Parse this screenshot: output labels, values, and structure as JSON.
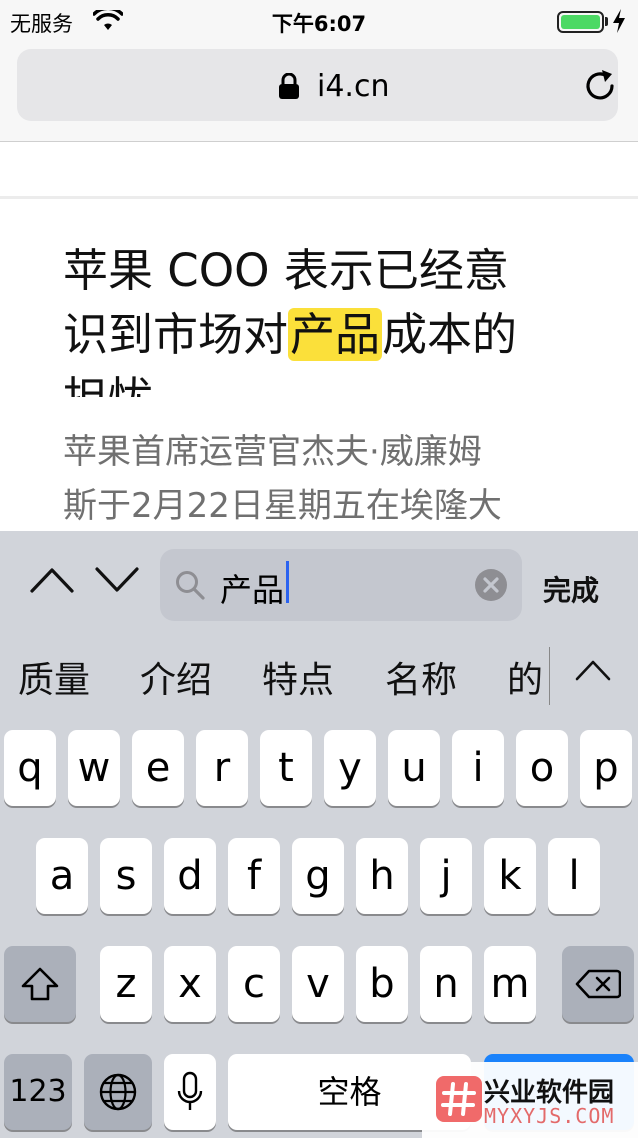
{
  "status_bar": {
    "carrier": "无服务",
    "time": "下午6:07",
    "battery_level": 1.0,
    "colors": {
      "battery": "#4cd964"
    }
  },
  "browser": {
    "url": "i4.cn",
    "icons": [
      "lock-icon",
      "reload-icon",
      "wifi-icon",
      "charging-icon"
    ]
  },
  "article": {
    "headline_lines": [
      "苹果 COO 表示已经意",
      "识到市场对",
      "产品",
      "成本的",
      "担忧"
    ],
    "summary_lines": [
      "苹果首席运营官杰夫·威廉姆",
      "斯于2月22日星期五在埃隆大"
    ],
    "colors": {
      "highlight": "#fbe03a"
    }
  },
  "find_bar": {
    "query": "产品",
    "done_label": "完成",
    "icons": [
      "chevron-up-icon",
      "chevron-down-icon",
      "search-icon",
      "clear-icon"
    ]
  },
  "candidates": {
    "items": [
      "质量",
      "介绍",
      "特点",
      "名称",
      "的"
    ]
  },
  "keyboard": {
    "row1": [
      "q",
      "w",
      "e",
      "r",
      "t",
      "y",
      "u",
      "i",
      "o",
      "p"
    ],
    "row2": [
      "a",
      "s",
      "d",
      "f",
      "g",
      "h",
      "j",
      "k",
      "l"
    ],
    "row3": [
      "z",
      "x",
      "c",
      "v",
      "b",
      "n",
      "m"
    ],
    "numbers_label": "123",
    "space_label": "空格",
    "colors": {
      "return_key": "#1a82fb"
    }
  },
  "watermark": {
    "title": "兴业软件园",
    "subtitle": "MYXYJS.COM"
  }
}
